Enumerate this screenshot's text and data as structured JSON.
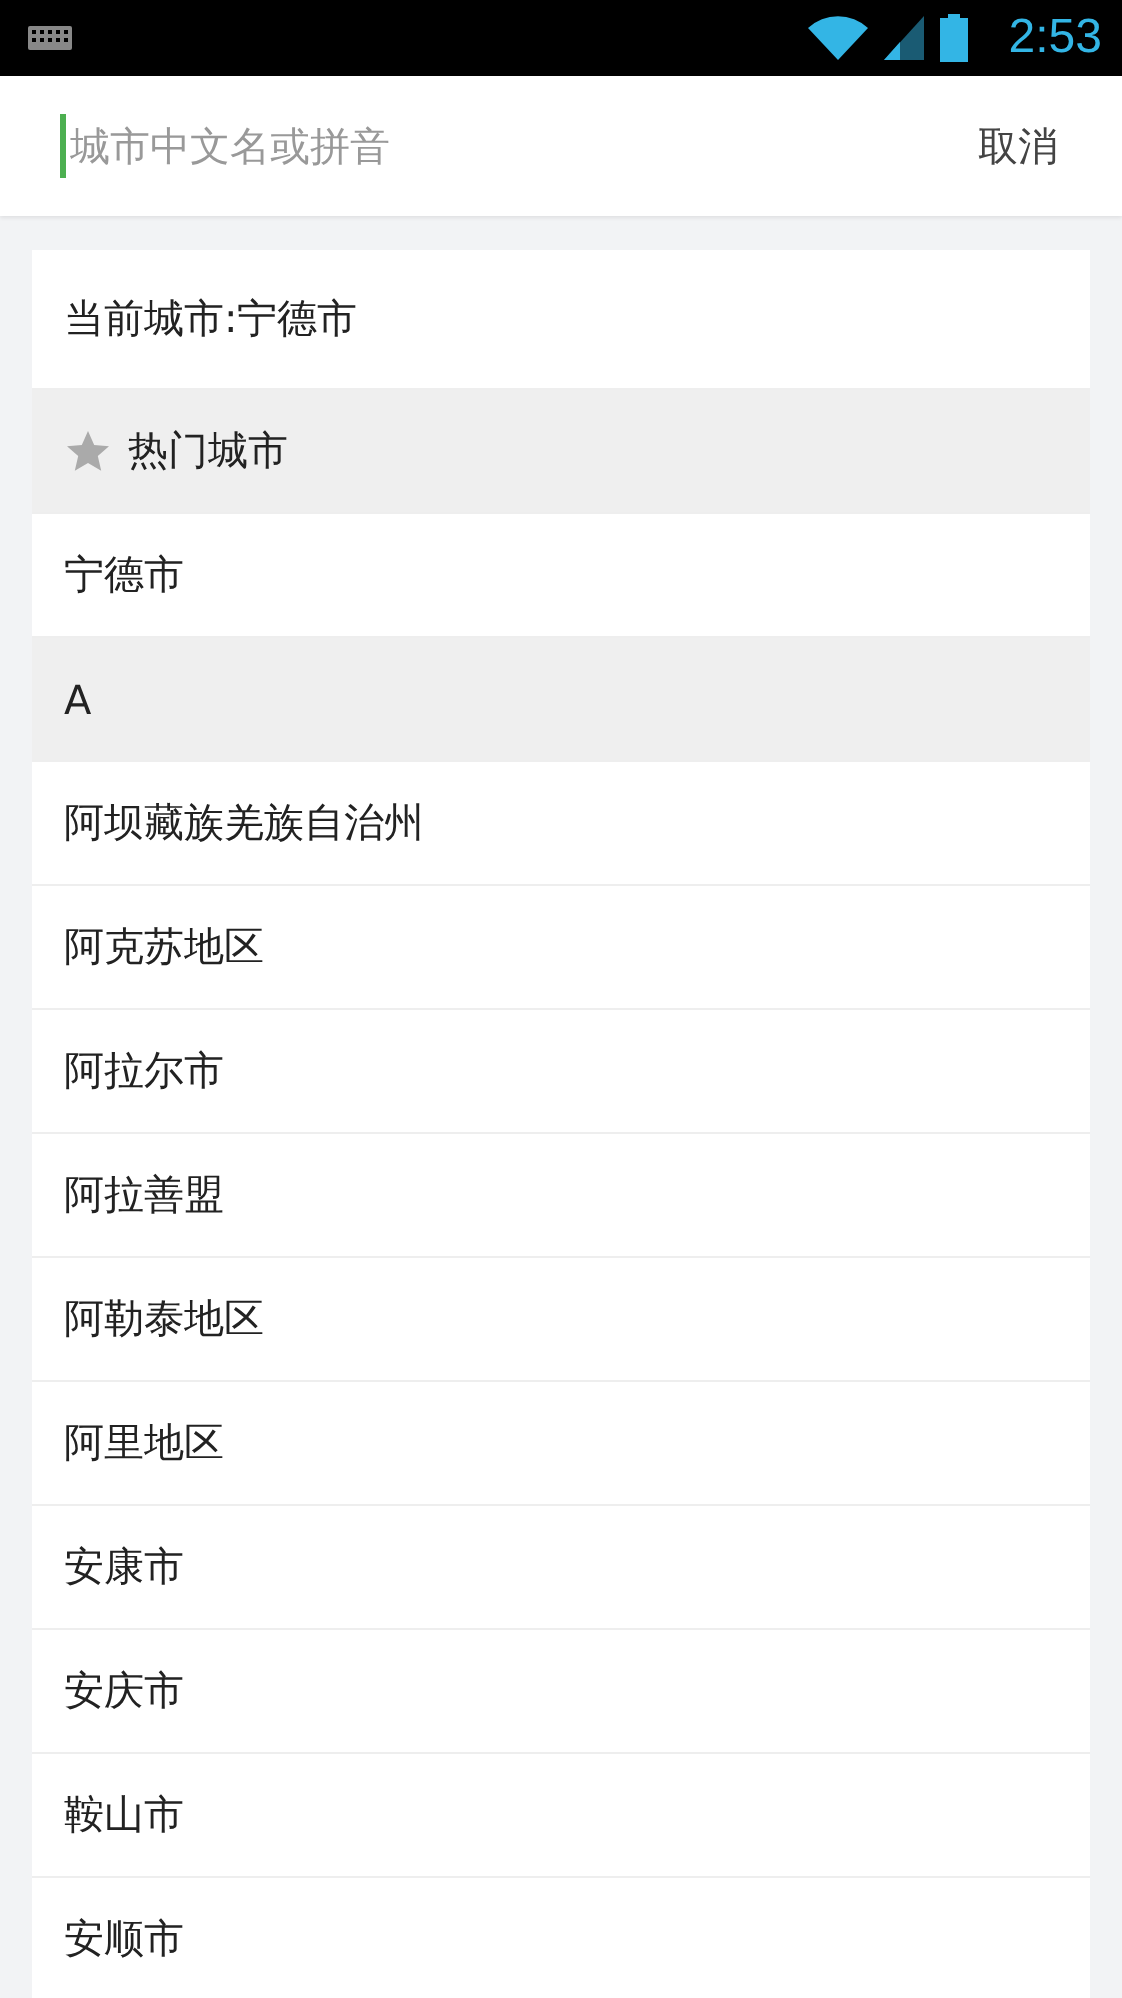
{
  "status_bar": {
    "time": "2:53"
  },
  "search": {
    "placeholder": "城市中文名或拼音",
    "cancel": "取消"
  },
  "list": [
    {
      "kind": "current",
      "label": "当前城市:宁德市"
    },
    {
      "kind": "header",
      "label": "热门城市",
      "starred": true
    },
    {
      "kind": "city",
      "label": "宁德市"
    },
    {
      "kind": "header",
      "label": "A",
      "starred": false
    },
    {
      "kind": "city",
      "label": "阿坝藏族羌族自治州"
    },
    {
      "kind": "city",
      "label": "阿克苏地区"
    },
    {
      "kind": "city",
      "label": "阿拉尔市"
    },
    {
      "kind": "city",
      "label": "阿拉善盟"
    },
    {
      "kind": "city",
      "label": "阿勒泰地区"
    },
    {
      "kind": "city",
      "label": "阿里地区"
    },
    {
      "kind": "city",
      "label": "安康市"
    },
    {
      "kind": "city",
      "label": "安庆市"
    },
    {
      "kind": "city",
      "label": "鞍山市"
    },
    {
      "kind": "city",
      "label": "安顺市"
    }
  ]
}
